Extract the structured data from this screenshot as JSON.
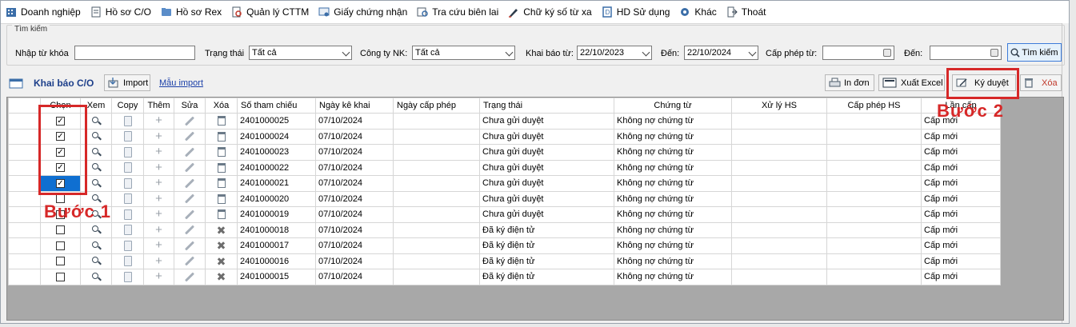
{
  "menu": [
    {
      "label": "Doanh nghiệp",
      "icon": "building-icon"
    },
    {
      "label": "Hồ sơ C/O",
      "icon": "document-icon"
    },
    {
      "label": "Hồ sơ Rex",
      "icon": "folder-icon"
    },
    {
      "label": "Quản lý CTTM",
      "icon": "file-search-icon"
    },
    {
      "label": "Giấy chứng nhận",
      "icon": "certificate-icon"
    },
    {
      "label": "Tra cứu biên lai",
      "icon": "receipt-icon"
    },
    {
      "label": "Chữ ký số từ xa",
      "icon": "pen-signature-icon"
    },
    {
      "label": "HD Sử dụng",
      "icon": "help-book-icon"
    },
    {
      "label": "Khác",
      "icon": "gear-icon"
    },
    {
      "label": "Thoát",
      "icon": "exit-icon"
    }
  ],
  "search": {
    "group_title": "Tìm kiếm",
    "keyword_label": "Nhập từ khóa",
    "keyword_value": "",
    "status_label": "Trạng thái",
    "status_value": "Tất cả",
    "company_label": "Công ty NK:",
    "company_value": "Tất cả",
    "declared_from_label": "Khai báo từ:",
    "declared_from_value": "22/10/2023",
    "declared_to_label": "Đến:",
    "declared_to_value": "22/10/2024",
    "permit_from_label": "Cấp phép từ:",
    "permit_from_value": "",
    "permit_to_label": "Đến:",
    "permit_to_value": "",
    "search_button": "Tìm kiếm"
  },
  "toolbar": {
    "declare_label": "Khai báo C/O",
    "import_label": "Import",
    "template_link": "Mẫu import",
    "print_label": "In đơn",
    "export_label": "Xuất Excel",
    "sign_label": "Ký duyệt",
    "delete_label": "Xóa"
  },
  "grid": {
    "columns": [
      "Chọn",
      "Xem",
      "Copy",
      "Thêm",
      "Sửa",
      "Xóa",
      "Số tham chiếu",
      "Ngày kê khai",
      "Ngày cấp phép",
      "Trạng thái",
      "Chứng từ",
      "Xử lý HS",
      "Cấp phép HS",
      "Lần cấp"
    ],
    "rows": [
      {
        "checked": true,
        "selected": false,
        "deletable": true,
        "ref": "2401000025",
        "date": "07/10/2024",
        "permit_date": "",
        "status": "Chưa gửi duyệt",
        "docs": "Không nợ chứng từ",
        "process": "",
        "permit": "",
        "issue": "Cấp mới"
      },
      {
        "checked": true,
        "selected": false,
        "deletable": true,
        "ref": "2401000024",
        "date": "07/10/2024",
        "permit_date": "",
        "status": "Chưa gửi duyệt",
        "docs": "Không nợ chứng từ",
        "process": "",
        "permit": "",
        "issue": "Cấp mới"
      },
      {
        "checked": true,
        "selected": false,
        "deletable": true,
        "ref": "2401000023",
        "date": "07/10/2024",
        "permit_date": "",
        "status": "Chưa gửi duyệt",
        "docs": "Không nợ chứng từ",
        "process": "",
        "permit": "",
        "issue": "Cấp mới"
      },
      {
        "checked": true,
        "selected": false,
        "deletable": true,
        "ref": "2401000022",
        "date": "07/10/2024",
        "permit_date": "",
        "status": "Chưa gửi duyệt",
        "docs": "Không nợ chứng từ",
        "process": "",
        "permit": "",
        "issue": "Cấp mới"
      },
      {
        "checked": true,
        "selected": true,
        "deletable": true,
        "ref": "2401000021",
        "date": "07/10/2024",
        "permit_date": "",
        "status": "Chưa gửi duyệt",
        "docs": "Không nợ chứng từ",
        "process": "",
        "permit": "",
        "issue": "Cấp mới"
      },
      {
        "checked": false,
        "selected": false,
        "deletable": true,
        "ref": "2401000020",
        "date": "07/10/2024",
        "permit_date": "",
        "status": "Chưa gửi duyệt",
        "docs": "Không nợ chứng từ",
        "process": "",
        "permit": "",
        "issue": "Cấp mới"
      },
      {
        "checked": false,
        "selected": false,
        "deletable": true,
        "ref": "2401000019",
        "date": "07/10/2024",
        "permit_date": "",
        "status": "Chưa gửi duyệt",
        "docs": "Không nợ chứng từ",
        "process": "",
        "permit": "",
        "issue": "Cấp mới"
      },
      {
        "checked": false,
        "selected": false,
        "deletable": false,
        "ref": "2401000018",
        "date": "07/10/2024",
        "permit_date": "",
        "status": "Đã ký điện tử",
        "docs": "Không nợ chứng từ",
        "process": "",
        "permit": "",
        "issue": "Cấp mới"
      },
      {
        "checked": false,
        "selected": false,
        "deletable": false,
        "ref": "2401000017",
        "date": "07/10/2024",
        "permit_date": "",
        "status": "Đã ký điện tử",
        "docs": "Không nợ chứng từ",
        "process": "",
        "permit": "",
        "issue": "Cấp mới"
      },
      {
        "checked": false,
        "selected": false,
        "deletable": false,
        "ref": "2401000016",
        "date": "07/10/2024",
        "permit_date": "",
        "status": "Đã ký điện tử",
        "docs": "Không nợ chứng từ",
        "process": "",
        "permit": "",
        "issue": "Cấp mới"
      },
      {
        "checked": false,
        "selected": false,
        "deletable": false,
        "ref": "2401000015",
        "date": "07/10/2024",
        "permit_date": "",
        "status": "Đã ký điện tử",
        "docs": "Không nợ chứng từ",
        "process": "",
        "permit": "",
        "issue": "Cấp mới"
      }
    ]
  },
  "annotations": {
    "step1": "Bước 1",
    "step2": "Bước 2",
    "color": "#d62828"
  },
  "colors": {
    "selection": "#0f6fd1",
    "grid_background": "#a8a8a8",
    "delete_text": "#c0392b"
  }
}
